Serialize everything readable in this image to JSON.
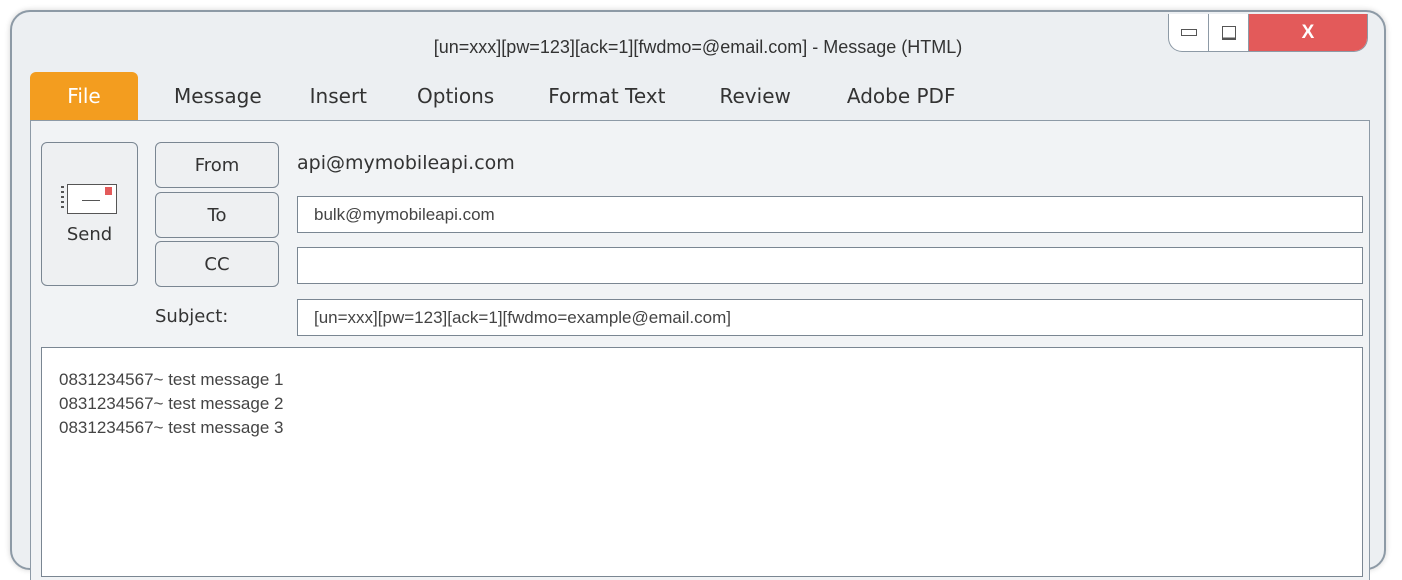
{
  "window": {
    "title": "[un=xxx][pw=123][ack=1][fwdmo=@email.com] - Message (HTML)",
    "close_label": "X"
  },
  "tabs": [
    {
      "label": "File",
      "active": true
    },
    {
      "label": "Message"
    },
    {
      "label": "Insert"
    },
    {
      "label": "Options"
    },
    {
      "label": "Format Text"
    },
    {
      "label": "Review"
    },
    {
      "label": "Adobe PDF"
    }
  ],
  "compose": {
    "send_label": "Send",
    "from_label": "From",
    "from_value": "api@mymobileapi.com",
    "to_label": "To",
    "to_value": "bulk@mymobileapi.com",
    "cc_label": "CC",
    "cc_value": "",
    "subject_label": "Subject:",
    "subject_value": "[un=xxx][pw=123][ack=1][fwdmo=example@email.com]",
    "body_lines": [
      "0831234567~ test message 1",
      "0831234567~ test message 2",
      "0831234567~ test message 3"
    ]
  },
  "colors": {
    "file_tab": "#f39d1f",
    "close_button": "#e35a5a",
    "window_bg": "#eceff2"
  }
}
